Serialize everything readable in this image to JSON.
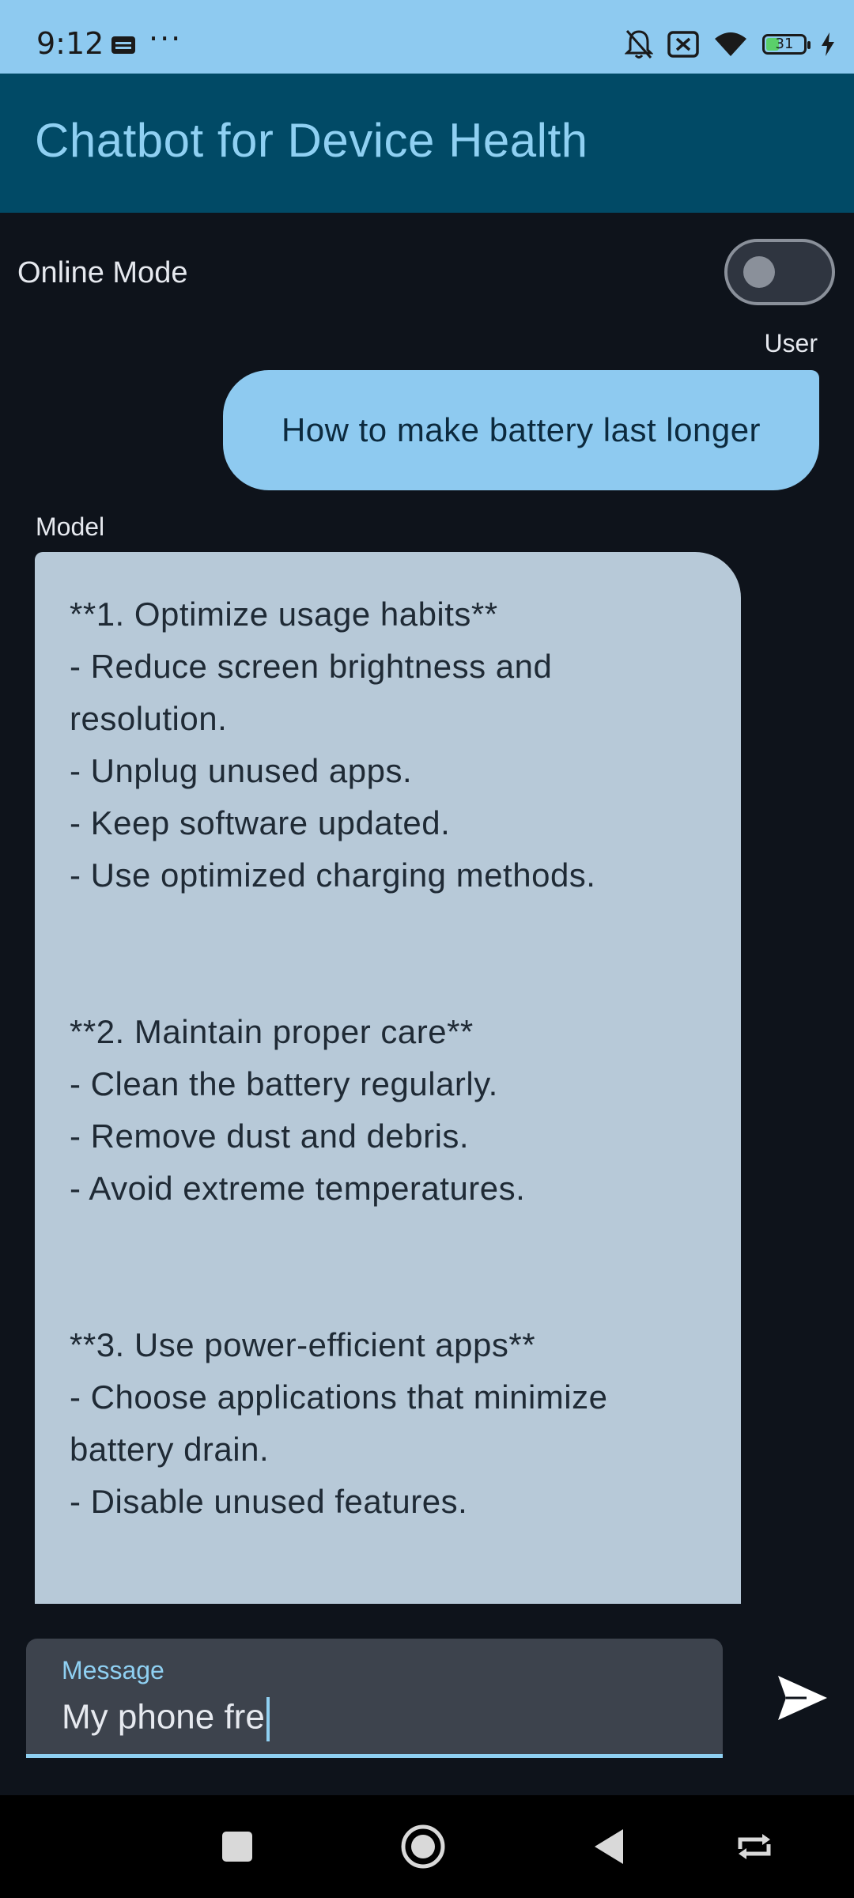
{
  "status_bar": {
    "time": "9:12",
    "more": "···",
    "battery_level": "31",
    "battery_fraction": 0.31,
    "icons": [
      "sim-card-icon",
      "bell-off-icon",
      "no-signal-icon",
      "wifi-icon",
      "battery-icon",
      "charging-icon"
    ]
  },
  "app_bar": {
    "title": "Chatbot for Device Health"
  },
  "settings": {
    "online_mode_label": "Online Mode",
    "online_mode_on": false
  },
  "chat": {
    "user_label": "User",
    "user_message": "How to make battery last longer",
    "model_label": "Model",
    "model_lines": [
      "**1. Optimize usage habits**",
      "- Reduce screen brightness and",
      "resolution.",
      "- Unplug unused apps.",
      "- Keep software updated.",
      "- Use optimized charging methods.",
      "",
      "",
      "**2. Maintain proper care**",
      "- Clean the battery regularly.",
      "- Remove dust and debris.",
      "- Avoid extreme temperatures.",
      "",
      "",
      "**3. Use power-efficient apps**",
      "- Choose applications that minimize",
      "battery drain.",
      "- Disable unused features."
    ]
  },
  "input": {
    "label": "Message",
    "value": "My phone fre"
  },
  "nav": {
    "icons": [
      "recents-square-icon",
      "home-circle-icon",
      "back-triangle-icon",
      "rotate-icon"
    ]
  },
  "colors": {
    "accent": "#8fd0f2",
    "app_bar": "#014a66",
    "status_bar": "#8ecaf0",
    "user_bubble": "#8ecaf0",
    "model_bubble": "#b7c9d8",
    "background": "#0e131b"
  }
}
